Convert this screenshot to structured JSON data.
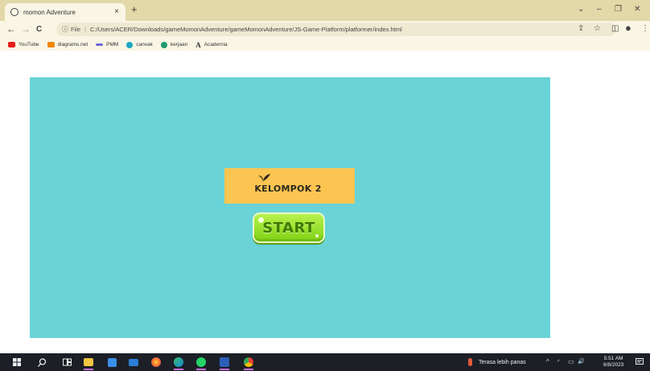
{
  "browser": {
    "tab_title": "momon Adventure",
    "tab_close": "×",
    "new_tab": "+",
    "window_controls": {
      "minimize": "⌄",
      "min": "–",
      "restore": "❐",
      "close": "✕"
    },
    "nav": {
      "back": "←",
      "forward": "→",
      "reload": "C"
    },
    "address": {
      "info_icon": "ⓘ",
      "scheme_label": "File",
      "separator": "|",
      "url": "C:/Users/ACER/Downloads/gameMomonAdventure/gameMomonAdventure/JS-Game-Platform/platformer/index.html"
    },
    "toolbar_icons": {
      "share": "⇪",
      "star": "☆",
      "sidepanel": "◫",
      "profile": "●",
      "menu": "⋮"
    },
    "bookmarks": [
      {
        "label": "YouTube",
        "icon": "youtube-icon",
        "color": "#e62117"
      },
      {
        "label": "diagrams.net",
        "icon": "drawio-icon",
        "color": "#f08705"
      },
      {
        "label": "PMM",
        "icon": "pmm-icon",
        "color": "#6b6bd6"
      },
      {
        "label": "canvak",
        "icon": "canva-icon",
        "color": "#1fa7c2"
      },
      {
        "label": "kerjaan",
        "icon": "kerjaan-icon",
        "color": "#1e9a6e"
      },
      {
        "label": "Academia",
        "icon": "academia-icon",
        "color": "#222222"
      }
    ]
  },
  "game": {
    "background": "#69d3d7",
    "banner_text": "KELOMPOK 2",
    "banner_color": "#fcc552",
    "start_label": "START",
    "start_color": "#8fdc1f"
  },
  "taskbar": {
    "apps": [
      {
        "name": "windows-start-icon"
      },
      {
        "name": "search-icon"
      },
      {
        "name": "task-view-icon"
      },
      {
        "name": "file-explorer-icon",
        "running": true
      },
      {
        "name": "microsoft-store-icon"
      },
      {
        "name": "mail-icon"
      },
      {
        "name": "firefox-icon"
      },
      {
        "name": "edge-icon",
        "running": true
      },
      {
        "name": "whatsapp-icon",
        "running": true
      },
      {
        "name": "word-icon",
        "running": true
      },
      {
        "name": "chrome-icon",
        "running": true
      }
    ],
    "weather_text": "Terasa lebih panas",
    "time": "5:51 AM",
    "date": "6/8/2023",
    "tray": {
      "chevron": "^",
      "wifi": "◜",
      "battery": "▭",
      "volume": "🔊"
    }
  }
}
